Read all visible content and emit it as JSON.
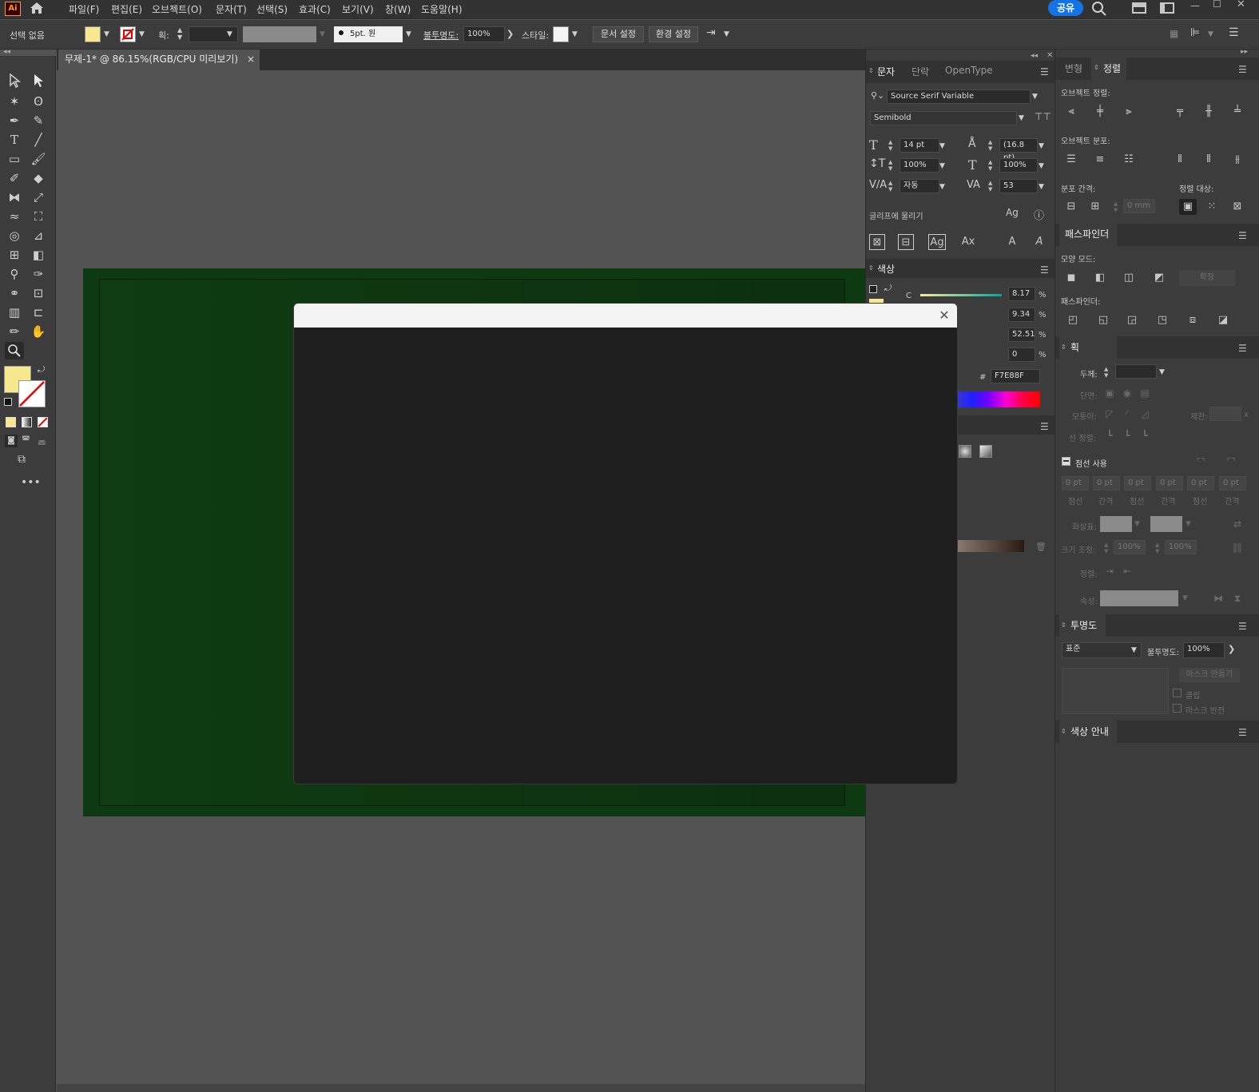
{
  "app": {
    "logo": "Ai",
    "share_label": "공유"
  },
  "menu": [
    "파일(F)",
    "편집(E)",
    "오브젝트(O)",
    "문자(T)",
    "선택(S)",
    "효과(C)",
    "보기(V)",
    "창(W)",
    "도움말(H)"
  ],
  "control_bar": {
    "selection": "선택 없음",
    "stroke_label": "획:",
    "brush": "5pt. 원",
    "opacity_label": "불투명도:",
    "opacity": "100%",
    "style_label": "스타일:",
    "doc_setup": "문서 설정",
    "prefs": "환경 설정"
  },
  "document": {
    "tab_title": "무제-1* @ 86.15%(RGB/CPU 미리보기)",
    "close": "×"
  },
  "char_panel": {
    "tabs": [
      "문자",
      "단락",
      "OpenType"
    ],
    "font_family": "Source Serif Variable",
    "font_style": "Semibold",
    "size": "14 pt",
    "leading": "(16.8 pt)",
    "vscale": "100%",
    "hscale": "100%",
    "kerning": "자동",
    "tracking": "53",
    "snap_label": "글리프에 물리기"
  },
  "color_panel": {
    "title": "색상",
    "c_label": "C",
    "values": [
      "8.17",
      "9.34",
      "52.51",
      "0"
    ],
    "pct": "%",
    "hex_label": "#",
    "hex": "F7E88F"
  },
  "align_panel": {
    "tabs": [
      "변형",
      "정렬"
    ],
    "object_align": "오브젝트 정렬:",
    "object_distribute": "오브젝트 분포:",
    "distribute_spacing": "분포 간격:",
    "align_to": "정렬 대상:",
    "spacing_value": "0 mm"
  },
  "pathfinder": {
    "title": "패스파인더",
    "shape_modes": "모양 모드:",
    "expand": "확장",
    "pathfinders": "패스파인더:"
  },
  "stroke_panel": {
    "title": "획",
    "weight": "두께:",
    "cap": "단면:",
    "corner": "모퉁이:",
    "limit": "제한:",
    "align": "선 정렬:",
    "dashed": "점선 사용",
    "dash_values": [
      "0 pt",
      "0 pt",
      "0 pt",
      "0 pt",
      "0 pt",
      "0 pt"
    ],
    "dash_labels": [
      "점선",
      "간격",
      "점선",
      "간격",
      "점선",
      "간격"
    ],
    "arrows": "화살표:",
    "scale": "크기 조정:",
    "scale_a": "100%",
    "scale_b": "100%",
    "arr_align": "정렬:",
    "profile": "속성:",
    "limit_x": "x"
  },
  "transparency": {
    "title": "투명도",
    "mode": "표준",
    "opacity_label": "불투명도:",
    "opacity": "100%",
    "make_mask": "마스크 만들기",
    "clip": "클립",
    "invert": "마스크 반전"
  },
  "color_guide": {
    "title": "색상 안내"
  },
  "colors": {
    "fill": "#f7e88f",
    "accent": "#1473e6",
    "artboard": "#0d3a10"
  }
}
